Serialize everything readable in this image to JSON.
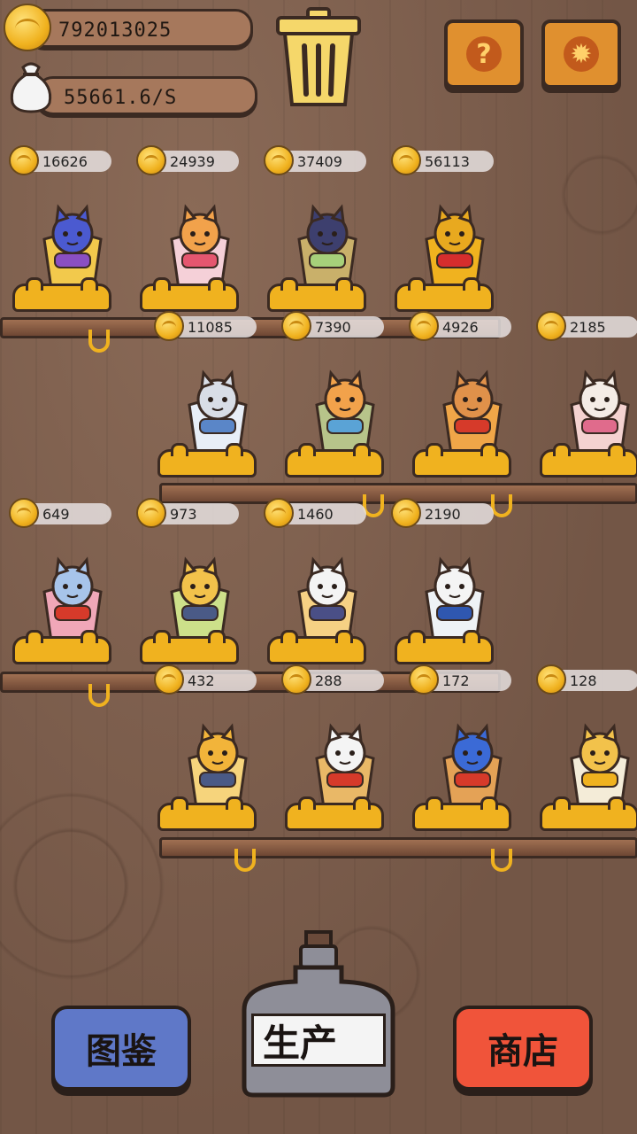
{
  "hud": {
    "coins": "792013025",
    "income_rate": "55661.6/S"
  },
  "icons": {
    "coin": "coin-icon",
    "money_bag": "money-bag-icon",
    "trash": "trash-can-icon",
    "help": "question-mark-icon",
    "settings": "gear-icon"
  },
  "colors": {
    "gold": "#f0b21f",
    "orange_button": "#e0902f",
    "blue_button": "#5f78c8",
    "red_button": "#f0543a",
    "wood": "#7a5b49"
  },
  "items": [
    {
      "price": "16626",
      "cup": "#f2c94c",
      "cat": "#4b5ad0",
      "accent": "#8a4fc2"
    },
    {
      "price": "24939",
      "cup": "#f5d0d8",
      "cat": "#f2a24b",
      "accent": "#e5566f"
    },
    {
      "price": "37409",
      "cup": "#c9b06a",
      "cat": "#3d3f6e",
      "accent": "#a6d07a"
    },
    {
      "price": "56113",
      "cup": "#f0b21f",
      "cat": "#e8a91f",
      "accent": "#d62d2d"
    },
    {
      "price": "11085",
      "cup": "#e8eef7",
      "cat": "#d8dde6",
      "accent": "#5a86c8"
    },
    {
      "price": "7390",
      "cup": "#b7c48a",
      "cat": "#f2a24b",
      "accent": "#5aa3d6"
    },
    {
      "price": "4926",
      "cup": "#f0a648",
      "cat": "#e0914a",
      "accent": "#d63a2a"
    },
    {
      "price": "2185",
      "cup": "#f4d2d0",
      "cat": "#f4ece6",
      "accent": "#e06b8c"
    },
    {
      "price": "649",
      "cup": "#f0a7b8",
      "cat": "#a7c4ea",
      "accent": "#d63a2a"
    },
    {
      "price": "973",
      "cup": "#cde08a",
      "cat": "#f2c24b",
      "accent": "#4a5a86"
    },
    {
      "price": "1460",
      "cup": "#f6d184",
      "cat": "#f4f4f4",
      "accent": "#4a4f86"
    },
    {
      "price": "2190",
      "cup": "#eef2f6",
      "cat": "#f4f4f4",
      "accent": "#2f57b0"
    },
    {
      "price": "432",
      "cup": "#f6d47c",
      "cat": "#f2b43a",
      "accent": "#4a5a86"
    },
    {
      "price": "288",
      "cup": "#e9b867",
      "cat": "#f4f4f4",
      "accent": "#d63a2a"
    },
    {
      "price": "172",
      "cup": "#e4a256",
      "cat": "#3b6ad6",
      "accent": "#d63a2a"
    },
    {
      "price": "128",
      "cup": "#f4ecd8",
      "cat": "#f2c24b",
      "accent": "#f0b21f"
    }
  ],
  "buttons": {
    "catalog": "图鉴",
    "produce": "生产",
    "shop": "商店"
  }
}
